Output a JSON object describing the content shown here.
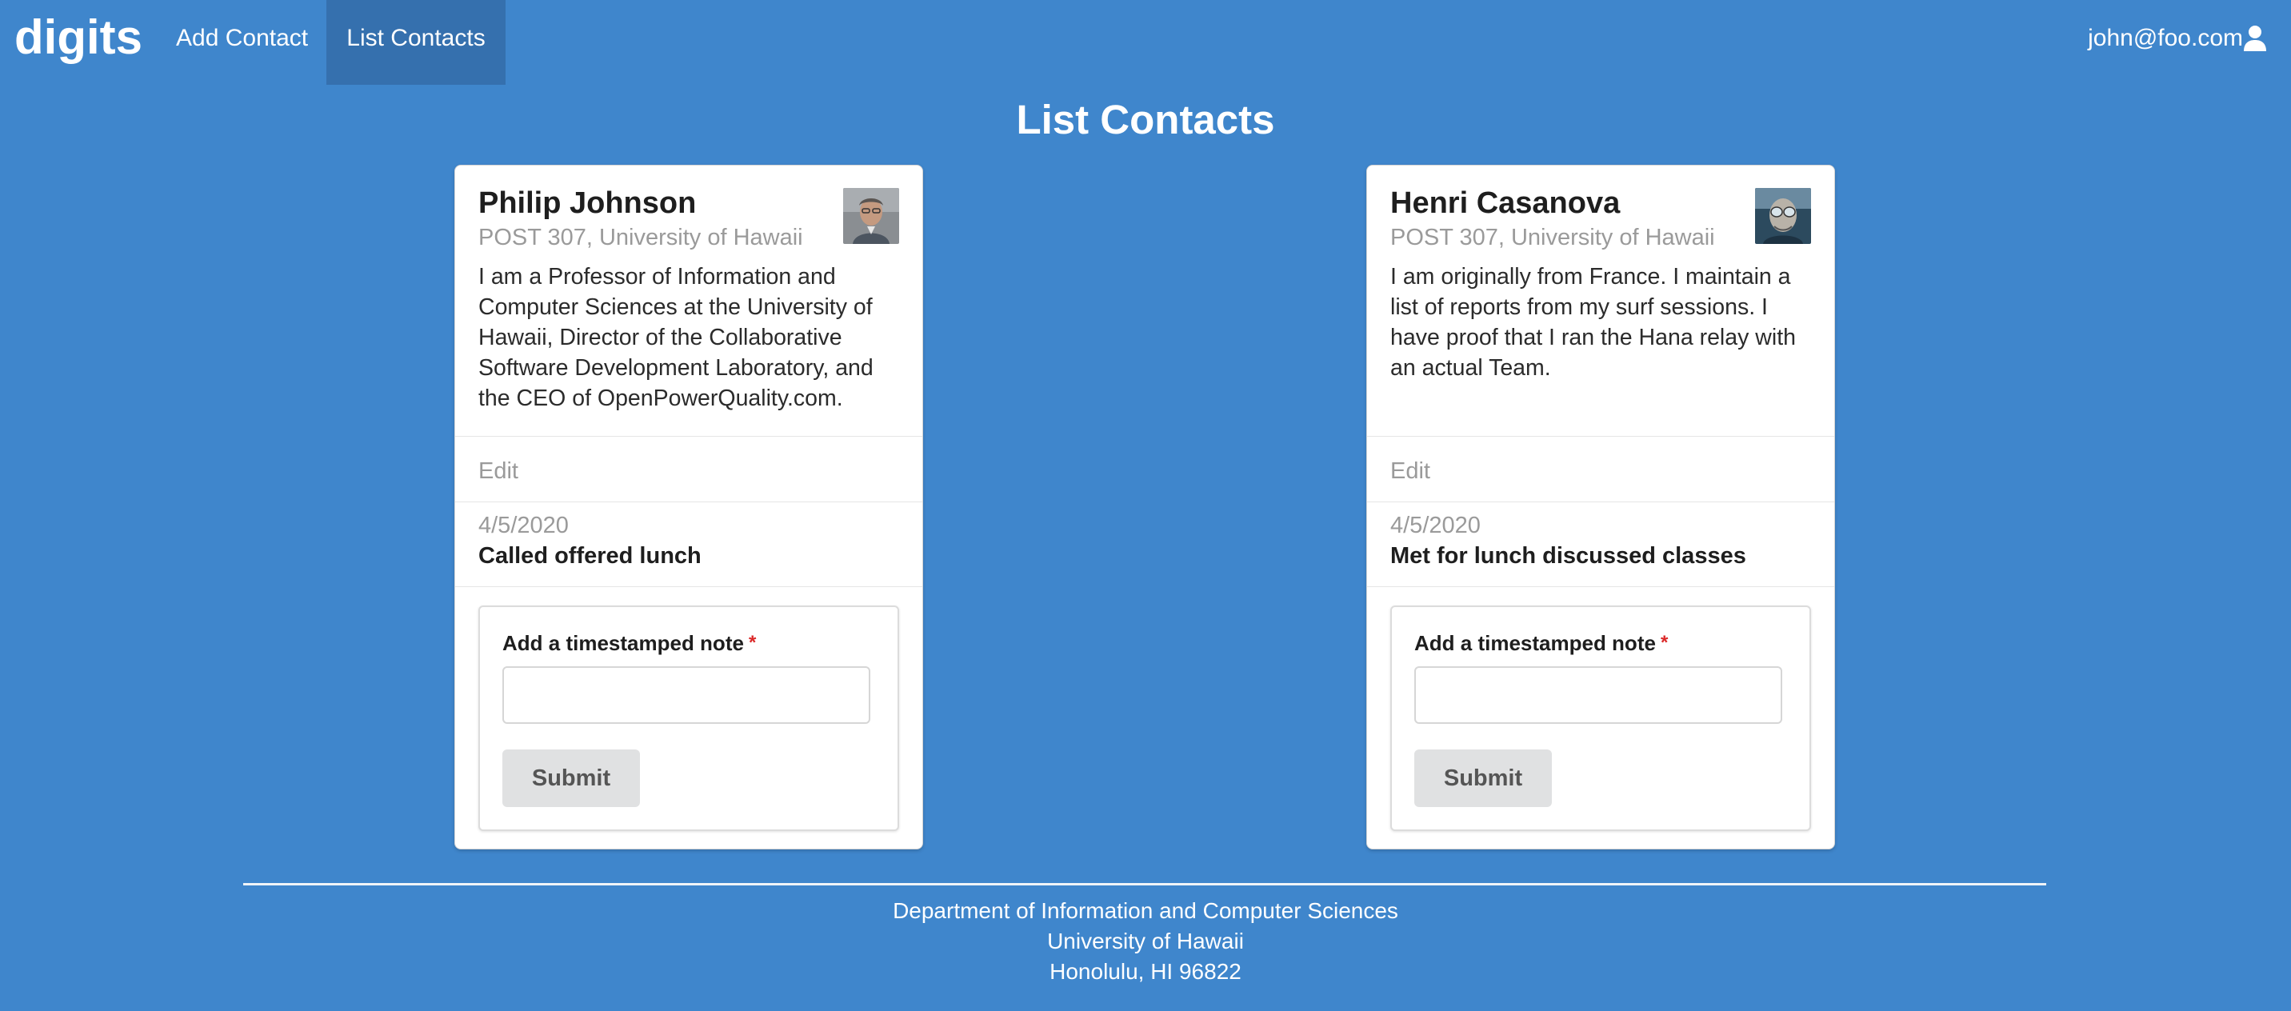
{
  "navbar": {
    "brand": "digits",
    "items": [
      {
        "label": "Add Contact",
        "active": false
      },
      {
        "label": "List Contacts",
        "active": true
      }
    ],
    "user_email": "john@foo.com",
    "user_icon": "user-icon"
  },
  "page": {
    "title": "List Contacts"
  },
  "contacts": [
    {
      "name": "Philip Johnson",
      "address": "POST 307, University of Hawaii",
      "description": "I am a Professor of Information and Computer Sciences at the University of Hawaii, Director of the Collaborative Software Development Laboratory, and the CEO of OpenPowerQuality.com.",
      "edit_label": "Edit",
      "note": {
        "date": "4/5/2020",
        "text": "Called offered lunch"
      },
      "form": {
        "label": "Add a timestamped note",
        "required_marker": "*",
        "input_value": "",
        "submit_label": "Submit"
      }
    },
    {
      "name": "Henri Casanova",
      "address": "POST 307, University of Hawaii",
      "description": "I am originally from France. I maintain a list of reports from my surf sessions. I have proof that I ran the Hana relay with an actual Team.",
      "edit_label": "Edit",
      "note": {
        "date": "4/5/2020",
        "text": "Met for lunch discussed classes"
      },
      "form": {
        "label": "Add a timestamped note",
        "required_marker": "*",
        "input_value": "",
        "submit_label": "Submit"
      }
    }
  ],
  "footer": {
    "lines": [
      "Department of Information and Computer Sciences",
      "University of Hawaii",
      "Honolulu, HI 96822"
    ]
  },
  "colors": {
    "background": "#3f86cc",
    "active_nav": "#3570ae",
    "required": "#db2828"
  }
}
